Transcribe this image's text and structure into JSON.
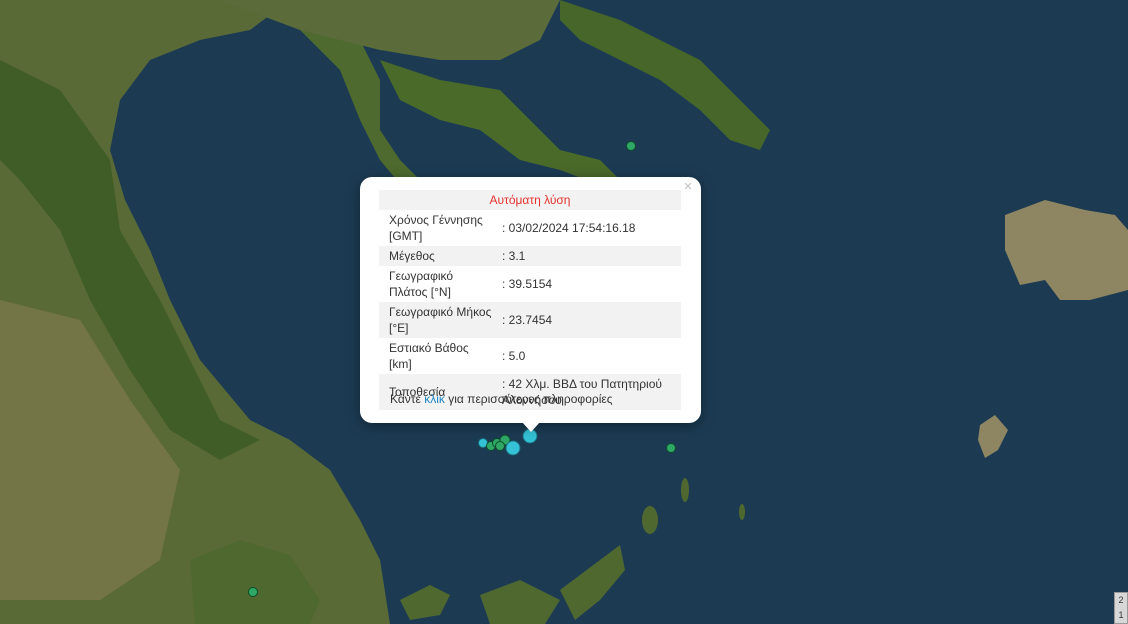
{
  "popup": {
    "title": "Αυτόματη λύση",
    "close_label": "×",
    "rows": [
      {
        "label": "Χρόνος Γέννησης [GMT]",
        "value": ": 03/02/2024 17:54:16.18"
      },
      {
        "label": "Μέγεθος",
        "value": ": 3.1"
      },
      {
        "label": "Γεωγραφικό Πλάτος [°N]",
        "value": ": 39.5154"
      },
      {
        "label": "Γεωγραφικό Μήκος [°E]",
        "value": ": 23.7454"
      },
      {
        "label": "Εστιακό Βάθος [km]",
        "value": ": 5.0"
      },
      {
        "label": "Τοποθεσία",
        "value": ": 42 Χλμ. ΒΒΔ του Πατητηριού Αλοννήσου"
      }
    ],
    "more_prefix": "Κάντε ",
    "more_link": "κλικ",
    "more_suffix": " για περισσότερες πληροφορίες"
  },
  "scale_control": {
    "top": "2",
    "bottom": "1"
  },
  "colors": {
    "sea": "#1b3a52",
    "land": "#4d6a2c",
    "quake_green": "#3aa66a",
    "quake_cyan": "#3bbad0"
  }
}
